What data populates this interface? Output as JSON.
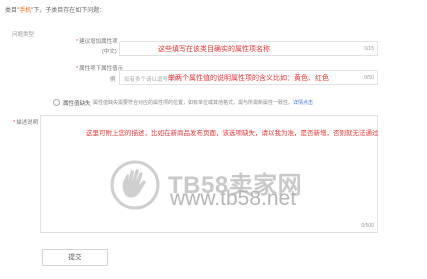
{
  "header": {
    "prefix": "类目\"",
    "category": "手机",
    "suffix": "\"下，子类目存在如下问题："
  },
  "section": {
    "label": "问题类型"
  },
  "field1": {
    "label": "建议增加属性项",
    "sublabel": "(中文)",
    "value": "",
    "counter": "0/15",
    "annotation": "这些填写在该类目确实的属性项名称"
  },
  "field2": {
    "label": "属性项下属性值示",
    "sublabel": "例",
    "placeholder": "如有多个请以逗号隔开",
    "counter": "0/50",
    "annotation": "举两个属性值的说明属性项的含义比如：黄色、红色"
  },
  "radio_option": {
    "label": "属性值缺失",
    "description": "属性值缺失需要符合对应的属性项的位置，如有单位或其他格式，需与所需新属性一致性。",
    "link": "详情点击"
  },
  "description": {
    "label": "描述说明",
    "annotation": "这里可附上您的描述，比如在新商品发布页面，该选项缺失，请以我为准，是否新增，否则就无法通过",
    "counter": "0/500"
  },
  "submit": {
    "label": "提交"
  },
  "watermark": {
    "text": "TB58卖家网",
    "url": "www.tb58.net"
  },
  "colors": {
    "accent": "#ff6a00",
    "annotation": "#e33333",
    "link": "#3a7bd5"
  }
}
